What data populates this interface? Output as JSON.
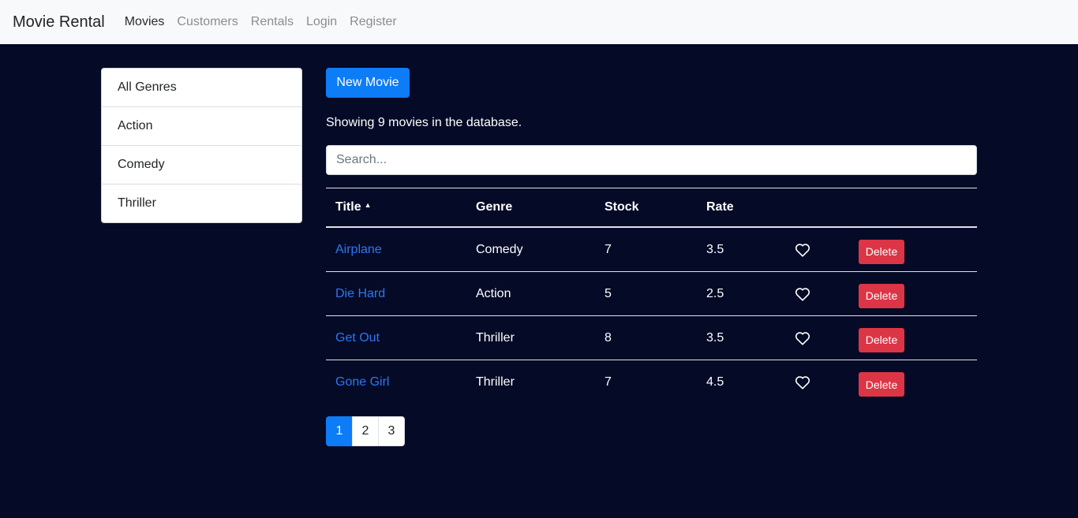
{
  "navbar": {
    "brand": "Movie Rental",
    "links": [
      "Movies",
      "Customers",
      "Rentals",
      "Login",
      "Register"
    ]
  },
  "genres": [
    "All Genres",
    "Action",
    "Comedy",
    "Thriller"
  ],
  "new_movie_label": "New Movie",
  "summary": "Showing 9 movies in the database.",
  "search": {
    "placeholder": "Search...",
    "value": ""
  },
  "table": {
    "headers": {
      "title": "Title",
      "genre": "Genre",
      "stock": "Stock",
      "rate": "Rate"
    },
    "sort_icon": "sort-up-icon",
    "rows": [
      {
        "title": "Airplane",
        "genre": "Comedy",
        "stock": "7",
        "rate": "3.5",
        "delete": "Delete"
      },
      {
        "title": "Die Hard",
        "genre": "Action",
        "stock": "5",
        "rate": "2.5",
        "delete": "Delete"
      },
      {
        "title": "Get Out",
        "genre": "Thriller",
        "stock": "8",
        "rate": "3.5",
        "delete": "Delete"
      },
      {
        "title": "Gone Girl",
        "genre": "Thriller",
        "stock": "7",
        "rate": "4.5",
        "delete": "Delete"
      }
    ]
  },
  "pagination": {
    "pages": [
      "1",
      "2",
      "3"
    ],
    "current": "1"
  },
  "colors": {
    "background": "#050a27",
    "navbar": "#f8f9fa",
    "primary": "#0d7cf7",
    "danger": "#dc3545",
    "link": "#2b78f0"
  }
}
